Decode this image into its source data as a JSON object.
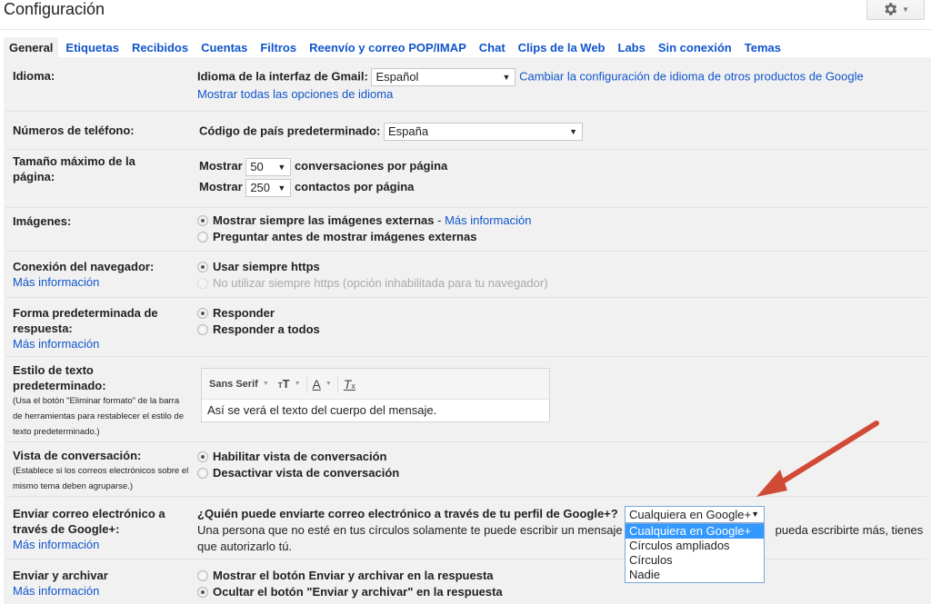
{
  "header": {
    "title": "Configuración",
    "settings_icon": "gear-icon"
  },
  "tabs": [
    {
      "label": "General",
      "active": true
    },
    {
      "label": "Etiquetas"
    },
    {
      "label": "Recibidos"
    },
    {
      "label": "Cuentas"
    },
    {
      "label": "Filtros"
    },
    {
      "label": "Reenvío y correo POP/IMAP"
    },
    {
      "label": "Chat"
    },
    {
      "label": "Clips de la Web"
    },
    {
      "label": "Labs"
    },
    {
      "label": "Sin conexión"
    },
    {
      "label": "Temas"
    }
  ],
  "settings": {
    "idioma": {
      "label": "Idioma:",
      "field_label": "Idioma de la interfaz de Gmail:",
      "value": "Español",
      "change_link": "Cambiar la configuración de idioma de otros productos de Google",
      "show_all_link": "Mostrar todas las opciones de idioma"
    },
    "telefono": {
      "label": "Números de teléfono:",
      "field_label": "Código de país predeterminado:",
      "value": "España"
    },
    "tamano": {
      "label": "Tamaño máximo de la página:",
      "show_label": "Mostrar",
      "conversations_value": "50",
      "conversations_suffix": "conversaciones por página",
      "contacts_value": "250",
      "contacts_suffix": "contactos por página"
    },
    "imagenes": {
      "label": "Imágenes:",
      "options": [
        {
          "label": "Mostrar siempre las imágenes externas",
          "checked": true
        },
        {
          "label": "Preguntar antes de mostrar imágenes externas",
          "checked": false
        }
      ],
      "separator": " - ",
      "more_info": "Más información"
    },
    "conexion": {
      "label": "Conexión del navegador:",
      "more_info": "Más información",
      "options": [
        {
          "label": "Usar siempre https",
          "checked": true
        },
        {
          "label": "No utilizar siempre https (opción inhabilitada para tu navegador)",
          "checked": false,
          "disabled": true
        }
      ]
    },
    "respuesta": {
      "label": "Forma predeterminada de respuesta:",
      "more_info": "Más información",
      "options": [
        {
          "label": "Responder",
          "checked": true
        },
        {
          "label": "Responder a todos",
          "checked": false
        }
      ]
    },
    "estilo": {
      "label": "Estilo de texto predeterminado:",
      "note": "(Usa el botón \"Eliminar formato\" de la barra de herramientas para restablecer el estilo de texto predeterminado.)",
      "toolbar": {
        "font": "Sans Serif",
        "size_icon": "text-size-icon",
        "color_icon": "text-color-icon",
        "clear_icon": "remove-formatting-icon"
      },
      "preview": "Así se verá el texto del cuerpo del mensaje."
    },
    "vista": {
      "label": "Vista de conversación:",
      "note": "(Establece si los correos electrónicos sobre el mismo tema deben agruparse.)",
      "options": [
        {
          "label": "Habilitar vista de conversación",
          "checked": true
        },
        {
          "label": "Desactivar vista de conversación",
          "checked": false
        }
      ]
    },
    "gplus": {
      "label": "Enviar correo electrónico a través de Google+:",
      "more_info": "Más información",
      "question": "¿Quién puede enviarte correo electrónico a través de tu perfil de Google+?",
      "description_start": "Una persona que no esté en tus círculos solamente te puede escribir un mensaje a",
      "description_end": "pueda escribirte más, tienes",
      "description_line2": "que autorizarlo tú.",
      "selected": "Cualquiera en Google+",
      "options": [
        "Cualquiera en Google+",
        "Círculos ampliados",
        "Círculos",
        "Nadie"
      ],
      "highlighted_option": 0
    },
    "archivar": {
      "label": "Enviar y archivar",
      "more_info": "Más información",
      "options": [
        {
          "label": "Mostrar el botón Enviar y archivar en la respuesta",
          "checked": false
        },
        {
          "label": "Ocultar el botón \"Enviar y archivar\" en la respuesta",
          "checked": true
        }
      ]
    }
  },
  "annotation": {
    "arrow_color": "#d14a36"
  },
  "colors": {
    "link": "#1155cc",
    "panel_bg": "#f1f1f1",
    "dropdown_highlight": "#3399ff"
  }
}
